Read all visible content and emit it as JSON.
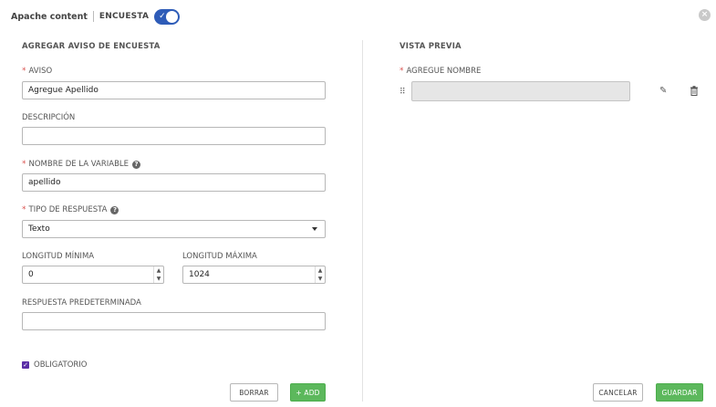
{
  "header": {
    "app_title": "Apache content",
    "survey_label": "ENCUESTA",
    "toggle_on": true
  },
  "form": {
    "section_title": "AGREGAR AVISO DE ENCUESTA",
    "prompt_label": "AVISO",
    "prompt_value": "Agregue Apellido",
    "description_label": "DESCRIPCIÓN",
    "description_value": "",
    "variable_label": "NOMBRE DE LA VARIABLE",
    "variable_value": "apellido",
    "answer_type_label": "TIPO DE RESPUESTA",
    "answer_type_value": "Texto",
    "min_length_label": "LONGITUD MÍNIMA",
    "min_length_value": "0",
    "max_length_label": "LONGITUD MÁXIMA",
    "max_length_value": "1024",
    "default_answer_label": "RESPUESTA PREDETERMINADA",
    "default_answer_value": "",
    "required_label": "OBLIGATORIO",
    "required_checked": true,
    "clear_button": "BORRAR",
    "add_button": "+ ADD"
  },
  "preview": {
    "section_title": "VISTA PREVIA",
    "field_label": "AGREGUE NOMBRE",
    "cancel_button": "CANCELAR",
    "save_button": "GUARDAR"
  },
  "icons": {
    "close": "close-icon",
    "help": "question-circle-icon",
    "drag": "drag-handle-icon",
    "edit": "pencil-icon",
    "delete": "trash-icon",
    "check": "check-icon",
    "caret": "caret-down-icon"
  },
  "colors": {
    "toggle": "#2e5cb8",
    "required_star": "#d9534f",
    "primary_green": "#5cb85c",
    "checkbox": "#5a2ea6"
  }
}
